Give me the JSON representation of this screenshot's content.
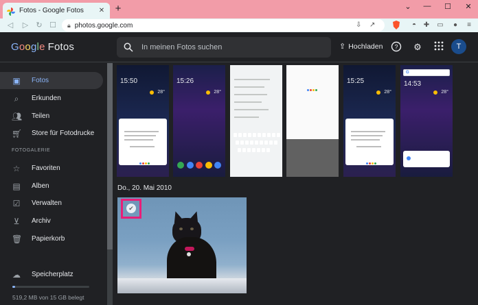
{
  "browser": {
    "tab_title": "Fotos - Google Fotos",
    "tab_close": "✕",
    "new_tab": "+",
    "url": "photos.google.com"
  },
  "app": {
    "logo_google": [
      "G",
      "o",
      "o",
      "g",
      "l",
      "e"
    ],
    "logo_product": "Fotos",
    "search_placeholder": "In meinen Fotos suchen",
    "upload_label": "Hochladen",
    "avatar_letter": "T"
  },
  "sidebar": {
    "items": [
      {
        "label": "Fotos",
        "icon": "image-icon"
      },
      {
        "label": "Erkunden",
        "icon": "search-icon"
      },
      {
        "label": "Teilen",
        "icon": "people-icon"
      },
      {
        "label": "Store für Fotodrucke",
        "icon": "cart-icon"
      }
    ],
    "section_title": "FOTOGALERIE",
    "gallery_items": [
      {
        "label": "Favoriten",
        "icon": "star-icon"
      },
      {
        "label": "Alben",
        "icon": "album-icon"
      },
      {
        "label": "Verwalten",
        "icon": "manage-icon"
      },
      {
        "label": "Archiv",
        "icon": "archive-icon"
      },
      {
        "label": "Papierkorb",
        "icon": "trash-icon"
      }
    ],
    "storage_label": "Speicherplatz",
    "storage_text": "519,2 MB von 15 GB belegt",
    "storage_fraction": 0.034
  },
  "main": {
    "screenshot_times": [
      "15:50",
      "15:26",
      "",
      "",
      "15:25",
      "14:53"
    ],
    "screenshot_temps": [
      "28°",
      "28°",
      "",
      "",
      "28°",
      "28°"
    ],
    "date_heading": "Do., 20. Mai 2010"
  },
  "colors": {
    "accent": "#8ab4f8",
    "selection": "#e91e78",
    "tabbar": "#f29ca8"
  }
}
